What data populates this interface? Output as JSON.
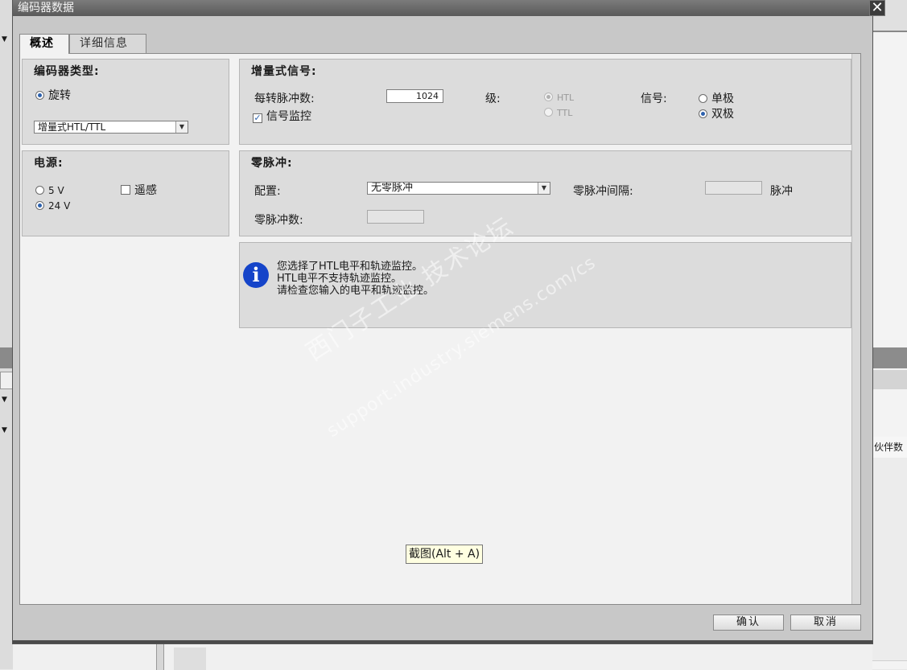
{
  "dialog": {
    "title": "编码器数据",
    "close_glyph": "✕",
    "tabs": [
      {
        "label": "概述",
        "active": true
      },
      {
        "label": "详细信息",
        "active": false
      }
    ]
  },
  "encoder_type": {
    "title": "编码器类型:",
    "option_rotation": "旋转",
    "select_value": "增量式HTL/TTL"
  },
  "incremental": {
    "title": "增量式信号:",
    "pulses_label": "每转脉冲数:",
    "pulses_value": "1024",
    "level_label": "级:",
    "level_options": [
      "HTL",
      "TTL"
    ],
    "signal_label": "信号:",
    "signal_options": [
      "单极",
      "双极"
    ],
    "monitor_label": "信号监控"
  },
  "power": {
    "title": "电源:",
    "options": [
      "5 V",
      "24 V"
    ],
    "remote_sense_label": "遥感"
  },
  "zero_pulse": {
    "title": "零脉冲:",
    "config_label": "配置:",
    "config_value": "无零脉冲",
    "interval_label": "零脉冲间隔:",
    "interval_unit": "脉冲",
    "count_label": "零脉冲数:"
  },
  "info": {
    "lines": [
      "您选择了HTL电平和轨迹监控。",
      "HTL电平不支持轨迹监控。",
      "请检查您输入的电平和轨迹监控。"
    ]
  },
  "watermark": {
    "line1": "西门子工业  技术论坛",
    "line2": "support.industry.siemens.com/cs"
  },
  "tooltip": {
    "text": "截图(Alt + A)"
  },
  "buttons": {
    "ok": "确认",
    "cancel": "取消"
  },
  "background": {
    "right_column_header": "伙伴数"
  }
}
